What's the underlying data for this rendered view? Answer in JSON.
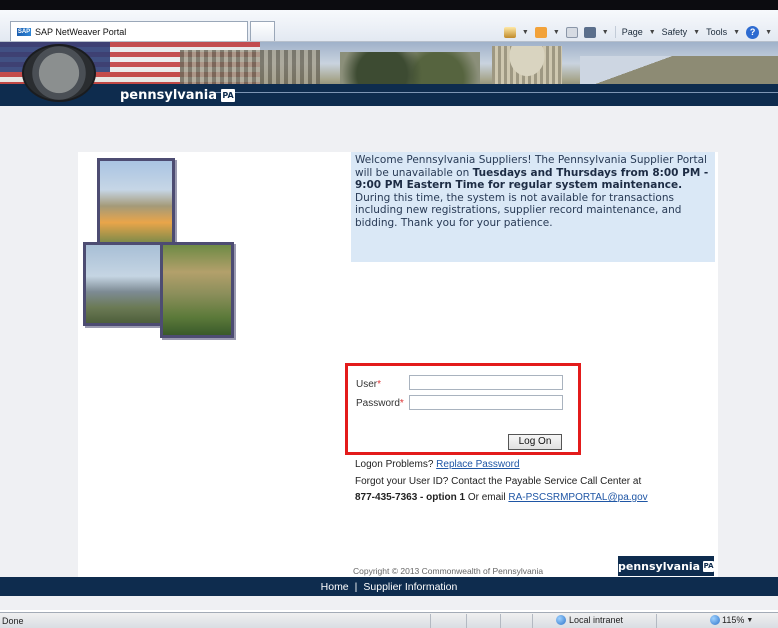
{
  "browser": {
    "tab_title": "SAP NetWeaver Portal",
    "sap_logo_text": "SAP",
    "commands": {
      "page": "Page",
      "safety": "Safety",
      "tools": "Tools",
      "help": "?"
    }
  },
  "header": {
    "logo_text": "pennsylvania",
    "logo_badge": "PA"
  },
  "notice": {
    "text_1": "Welcome Pennsylvania Suppliers! The Pennsylvania Supplier Portal will be unavailable on ",
    "bold": "Tuesdays and Thursdays from 8:00 PM - 9:00 PM Eastern Time for regular system maintenance.",
    "text_2": " During this time, the system is not available for transactions including new registrations, supplier record maintenance, and bidding. Thank you for your patience."
  },
  "login": {
    "user_label": "User",
    "password_label": "Password",
    "required_mark": "*",
    "user_value": "",
    "password_value": "",
    "logon_button": "Log On"
  },
  "help": {
    "logon_problems": "Logon Problems?",
    "replace_password": "Replace Password",
    "forgot_line": "Forgot your User ID? Contact the Payable Service Call Center at",
    "phone": "877-435-7363 - option 1",
    "or_email": "Or email",
    "email": "RA-PSCSRMPORTAL@pa.gov"
  },
  "footer": {
    "copyright": "Copyright © 2013 Commonwealth of Pennsylvania",
    "logo_text": "pennsylvania",
    "logo_badge": "PA",
    "nav_home": "Home",
    "nav_sep": "|",
    "nav_supplier": "Supplier Information"
  },
  "statusbar": {
    "status": "Done",
    "zone": "Local intranet",
    "zoom": "115%"
  }
}
